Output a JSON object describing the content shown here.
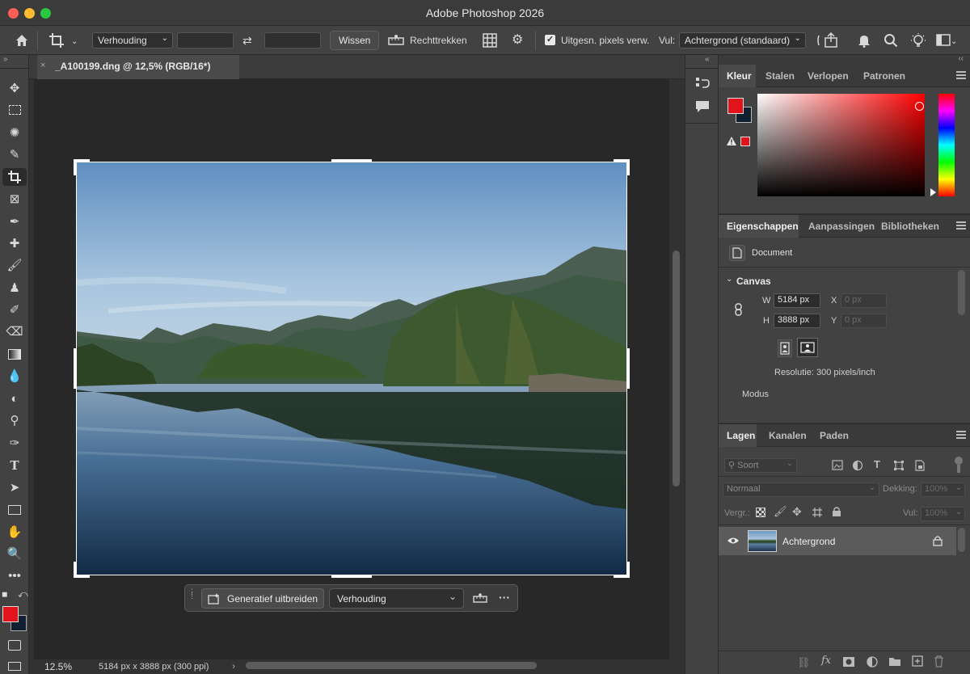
{
  "window": {
    "title": "Adobe Photoshop 2026"
  },
  "options_bar": {
    "ratio_dropdown": "Verhouding",
    "clear_button": "Wissen",
    "straighten_label": "Rechttrekken",
    "delete_pixels_label": "Uitgesn. pixels verw.",
    "delete_pixels_checked": true,
    "fill_label": "Vul:",
    "fill_dropdown": "Achtergrond (standaard)"
  },
  "document": {
    "tab_title": "_A100199.dng @ 12,5% (RGB/16*)",
    "zoom": "12.5%",
    "info": "5184 px x 3888 px (300 ppi)"
  },
  "contextual_bar": {
    "generative_expand": "Generatief uitbreiden",
    "ratio_dropdown": "Verhouding"
  },
  "color_panel": {
    "tabs": [
      "Kleur",
      "Stalen",
      "Verlopen",
      "Patronen"
    ],
    "foreground": "#e0141a",
    "background": "#102030"
  },
  "properties_panel": {
    "tabs": [
      "Eigenschappen",
      "Aanpassingen",
      "Bibliotheken"
    ],
    "document_label": "Document",
    "section": "Canvas",
    "w_label": "W",
    "w_value": "5184 px",
    "h_label": "H",
    "h_value": "3888 px",
    "x_label": "X",
    "x_value": "0 px",
    "y_label": "Y",
    "y_value": "0 px",
    "resolution": "Resolutie: 300 pixels/inch",
    "mode_label": "Modus"
  },
  "layers_panel": {
    "tabs": [
      "Lagen",
      "Kanalen",
      "Paden"
    ],
    "search_placeholder": "Soort",
    "blend_mode": "Normaal",
    "opacity_label": "Dekking:",
    "opacity_value": "100%",
    "lock_label": "Vergr.:",
    "fill_label": "Vul:",
    "fill_value": "100%",
    "layers": [
      {
        "name": "Achtergrond",
        "visible": true,
        "locked": true
      }
    ]
  }
}
